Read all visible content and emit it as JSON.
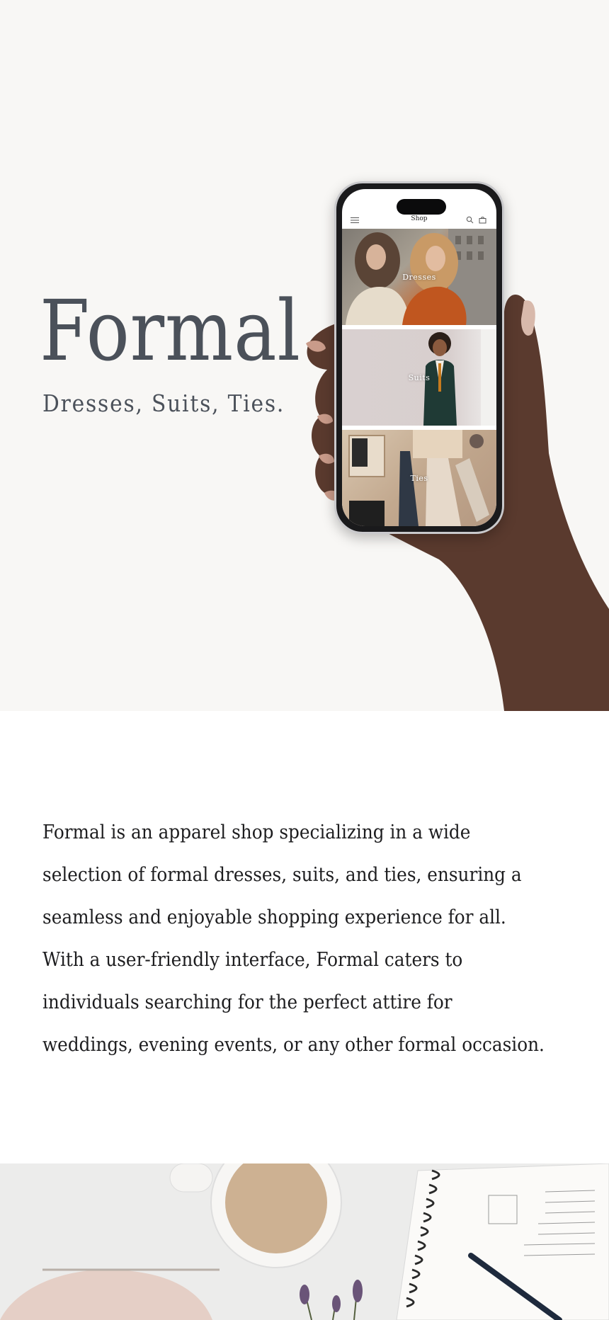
{
  "hero": {
    "title": "Formal",
    "subtitle": "Dresses, Suits, Ties."
  },
  "phone": {
    "app_title": "Shop",
    "icons": [
      "menu-icon",
      "search-icon",
      "bag-icon"
    ],
    "categories": [
      {
        "label": "Dresses"
      },
      {
        "label": "Suits"
      },
      {
        "label": "Ties"
      }
    ]
  },
  "description": {
    "lines": [
      "Formal is an apparel shop specializing in a wide",
      "selection of formal dresses, suits, and ties, ensuring a",
      "seamless and enjoyable shopping experience for all.",
      "With a user-friendly interface, Formal caters to",
      "individuals searching for the perfect attire for",
      "weddings, evening events, or any other formal occasion."
    ]
  },
  "colors": {
    "hero_background": "#f8f7f5",
    "title_color": "#4b515a",
    "text_color": "#1d1d1f"
  }
}
